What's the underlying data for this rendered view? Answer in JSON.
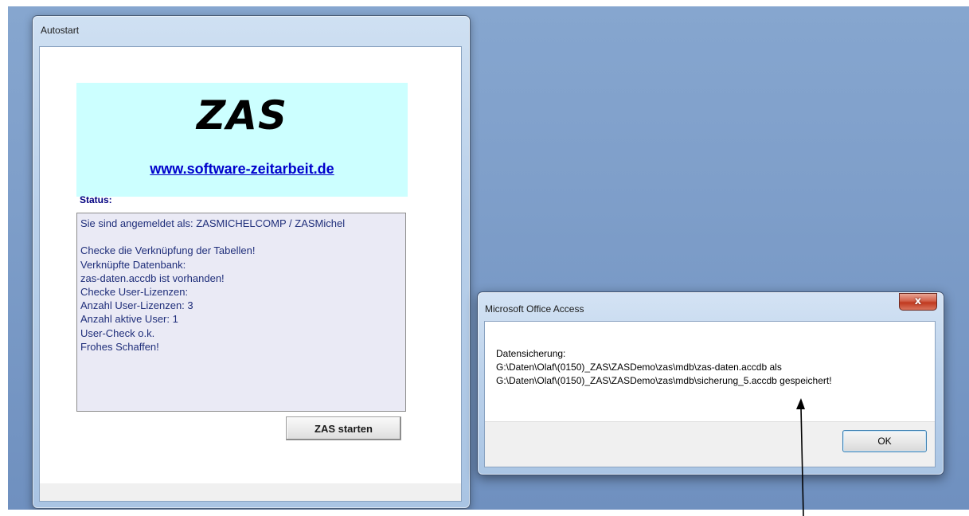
{
  "autostart_window": {
    "title": "Autostart",
    "logo_text": "ZAS",
    "website_link": "www.software-zeitarbeit.de",
    "status_label": "Status:",
    "status_lines": [
      "Sie sind angemeldet als: ZASMICHELCOMP / ZASMichel",
      "",
      "Checke die Verknüpfung der Tabellen!",
      "Verknüpfte Datenbank:",
      "zas-daten.accdb ist vorhanden!",
      "Checke User-Lizenzen:",
      "Anzahl User-Lizenzen: 3",
      "Anzahl aktive User: 1",
      "User-Check o.k.",
      "Frohes Schaffen!"
    ],
    "start_button_label": "ZAS starten"
  },
  "access_dialog": {
    "title": "Microsoft Office Access",
    "close_label": "x",
    "message_lines": [
      "Datensicherung:",
      "G:\\Daten\\Olaf\\(0150)_ZAS\\ZASDemo\\zas\\mdb\\zas-daten.accdb als",
      "G:\\Daten\\Olaf\\(0150)_ZAS\\ZASDemo\\zas\\mdb\\sicherung_5.accdb gespeichert!"
    ],
    "ok_button_label": "OK"
  },
  "icons": [
    "close-icon",
    "annotation-arrow-icon"
  ],
  "colors": {
    "desktop": "#7f9fca",
    "banner": "#ccffff",
    "status_text": "#1f2e7a",
    "link": "#0000cc",
    "close_button": "#c0391f"
  }
}
